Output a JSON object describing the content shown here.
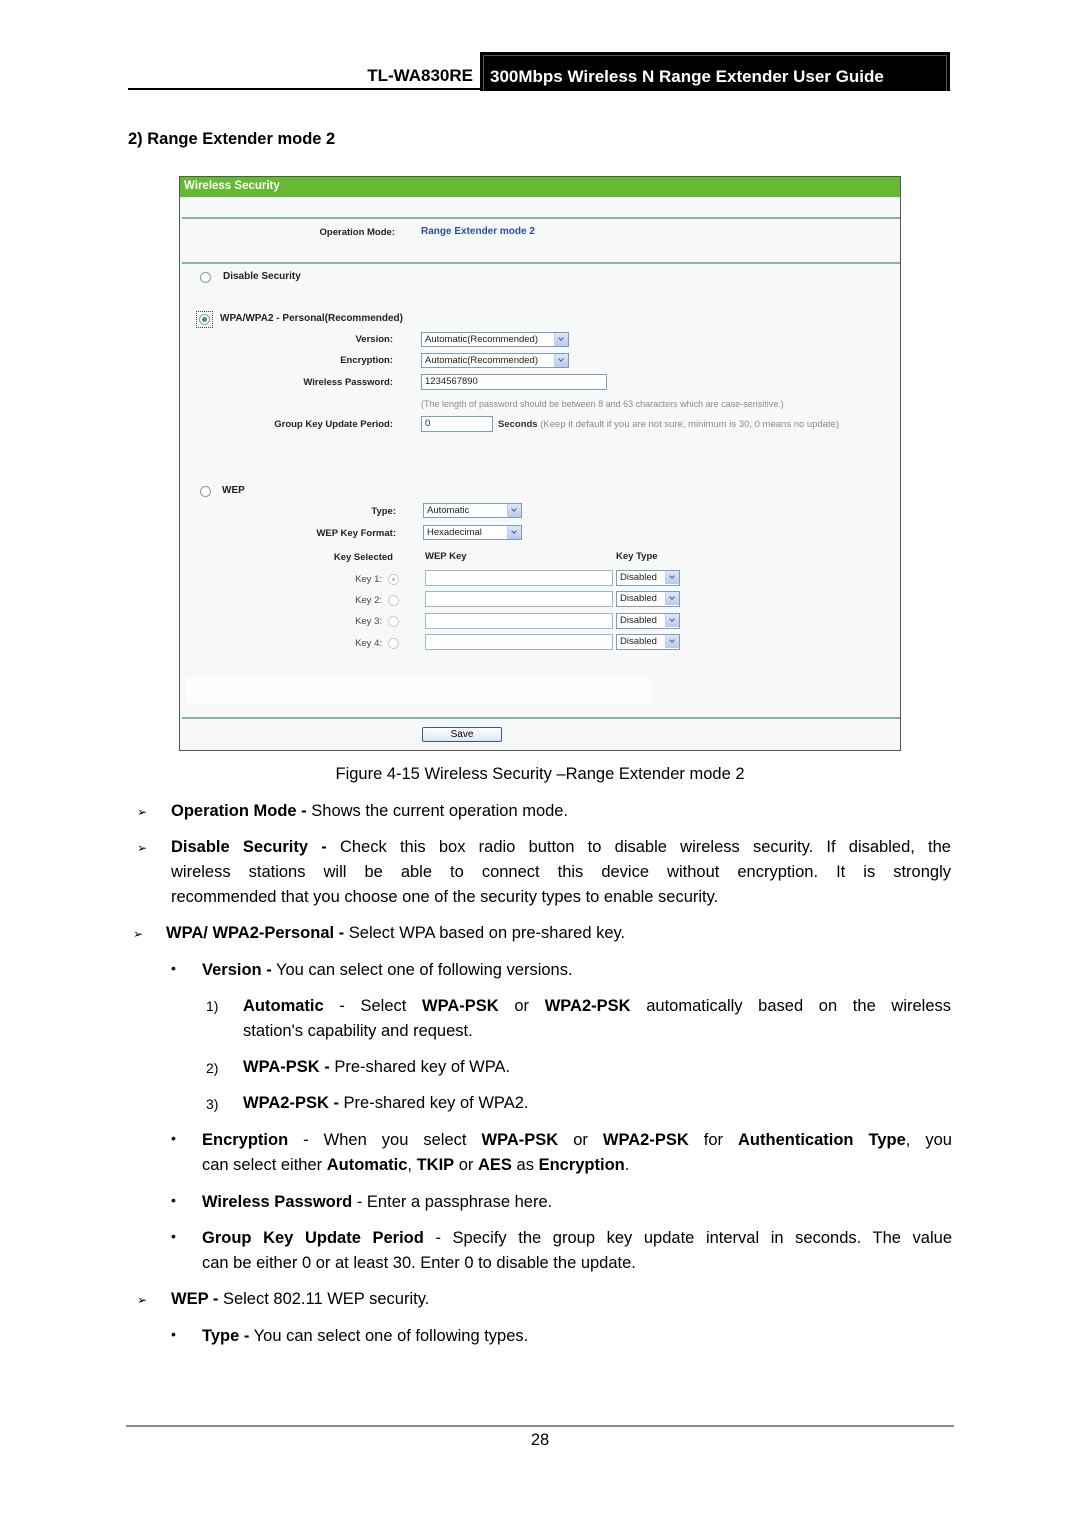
{
  "header": {
    "model": "TL-WA830RE",
    "guide_title": "300Mbps Wireless N Range Extender User Guide"
  },
  "section_heading": "2) Range Extender mode 2",
  "screenshot": {
    "panel_title": "Wireless Security",
    "header_color": "#66b933",
    "operation_mode": {
      "label": "Operation Mode:",
      "value": "Range Extender mode 2"
    },
    "disable_security": {
      "label": "Disable Security",
      "selected": false
    },
    "wpa": {
      "label": "WPA/WPA2 - Personal(Recommended)",
      "selected": true,
      "version": {
        "label": "Version:",
        "value": "Automatic(Recommended)"
      },
      "encryption": {
        "label": "Encryption:",
        "value": "Automatic(Recommended)"
      },
      "password": {
        "label": "Wireless Password:",
        "value": "1234567890"
      },
      "password_hint": "(The length of password should be between 8 and 63 characters which are case-sensitive.)",
      "group_key": {
        "label": "Group Key Update Period:",
        "value": "0"
      },
      "seconds_label": "Seconds",
      "seconds_hint": "(Keep it default if you are not sure, minimum is 30, 0 means no update)"
    },
    "wep": {
      "label": "WEP",
      "selected": false,
      "type": {
        "label": "Type:",
        "value": "Automatic"
      },
      "format": {
        "label": "WEP Key Format:",
        "value": "Hexadecimal"
      },
      "col_key_selected": "Key Selected",
      "col_wep_key": "WEP Key",
      "col_key_type": "Key Type",
      "keys": [
        {
          "label": "Key 1:",
          "selected": true,
          "value": "",
          "type": "Disabled"
        },
        {
          "label": "Key 2:",
          "selected": false,
          "value": "",
          "type": "Disabled"
        },
        {
          "label": "Key 3:",
          "selected": false,
          "value": "",
          "type": "Disabled"
        },
        {
          "label": "Key 4:",
          "selected": false,
          "value": "",
          "type": "Disabled"
        }
      ]
    },
    "save_label": "Save"
  },
  "caption": "Figure 4-15 Wireless Security –Range Extender mode 2",
  "body": {
    "operation_mode": {
      "term": "Operation Mode -",
      "text": " Shows the current operation mode."
    },
    "disable_security": {
      "term": "Disable Security -",
      "line1": " Check this box radio button to disable wireless security. If disabled, the",
      "line2": "wireless stations will be able to connect this device without encryption. It is strongly",
      "line3": "recommended that you choose one of the security types to enable security."
    },
    "wpa_personal": {
      "term": "WPA/ WPA2-Personal -",
      "text": " Select WPA based on pre-shared key."
    },
    "version": {
      "term": "Version -",
      "text": " You can select one of following versions."
    },
    "version_items": [
      {
        "num": "1)",
        "term": "Automatic",
        "t1": " - Select ",
        "b1": "WPA-PSK",
        "t2": " or ",
        "b2": "WPA2-PSK",
        "t3": " automatically based on the wireless",
        "line2": "station's capability and request."
      },
      {
        "num": "2)",
        "term": "WPA-PSK -",
        "text": " Pre-shared key of WPA."
      },
      {
        "num": "3)",
        "term": "WPA2-PSK -",
        "text": " Pre-shared key of WPA2."
      }
    ],
    "encryption": {
      "term": "Encryption",
      "t1": " - When you select ",
      "b1": "WPA-PSK",
      "t2": " or ",
      "b2": "WPA2-PSK",
      "t3": " for ",
      "b3": "Authentication Type",
      "t4": ", you",
      "l2a": "can select either ",
      "l2b": "Automatic",
      "l2c": ", ",
      "l2d": "TKIP",
      "l2e": " or ",
      "l2f": "AES",
      "l2g": " as ",
      "l2h": "Encryption",
      "l2i": "."
    },
    "wireless_password": {
      "term": "Wireless Password",
      "text": " - Enter a passphrase here."
    },
    "group_key": {
      "term": "Group Key Update Period",
      "line1": " - Specify the group key update interval in seconds. The value",
      "line2": "can be either 0 or at least 30. Enter 0 to disable the update."
    },
    "wep": {
      "term": "WEP -",
      "text": " Select 802.11 WEP security."
    },
    "type": {
      "term": "Type -",
      "text": " You can select one of following types."
    }
  },
  "icons": {
    "arrow_bullet": "➢",
    "dot_bullet": "•"
  },
  "page_number": "28"
}
